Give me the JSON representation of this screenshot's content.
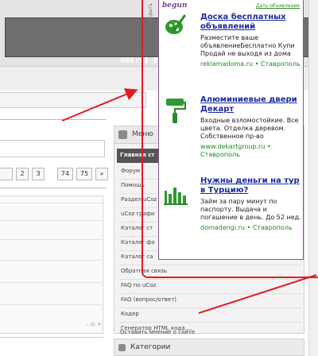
{
  "banner": {
    "text": "468:61 E"
  },
  "pager": {
    "pages": [
      "2",
      "3",
      "74",
      "75",
      "»"
    ]
  },
  "sidebar": {
    "menu_label": "Меню",
    "active_item": "Главная ст",
    "items": [
      "Форум",
      "Помощь",
      "Раздел uCoz",
      "uCoz графи",
      "Каталог ст",
      "Каталог фа",
      "Каталог са",
      "Обратная связь",
      "FAQ по uCoz",
      "FAQ (вопрос/ответ)",
      "Кодер",
      "Генератор HTML кода ...",
      "Оставить мнение о сайте"
    ],
    "category_label": "Категории"
  },
  "ad": {
    "logo": "begun",
    "post_link": "Дать объявление",
    "close_text": "x  закрыть",
    "items": [
      {
        "title": "Доска бесплатных объявлений",
        "desc": "Разместите ваше объявлениеБесплатно Купи Продай не выходя из дома",
        "url": "reklamadoma.ru • Ставрополь",
        "icon": "palette-brush-icon"
      },
      {
        "title": "Алюминиевые двери Декарт",
        "desc": "Входные взломостойкие. Все цвета. Отделка деревом. Собственное пр-во",
        "url": "www.dekartgroup.ru • Ставрополь",
        "icon": "paint-roller-icon"
      },
      {
        "title": "Нужны деньги на тур в Турцию?",
        "desc": "Займ за пару минут по паспорту. Выдача и погашение в день. До 52 нед.",
        "url": "domadengi.ru • Ставрополь",
        "icon": "bar-chart-icon"
      }
    ]
  },
  "colors": {
    "annotation_red": "#e21b22",
    "ad_title_blue": "#1a2aa8",
    "ad_url_green": "#1d8a1d",
    "ad_border_purple": "#8a4f98"
  }
}
